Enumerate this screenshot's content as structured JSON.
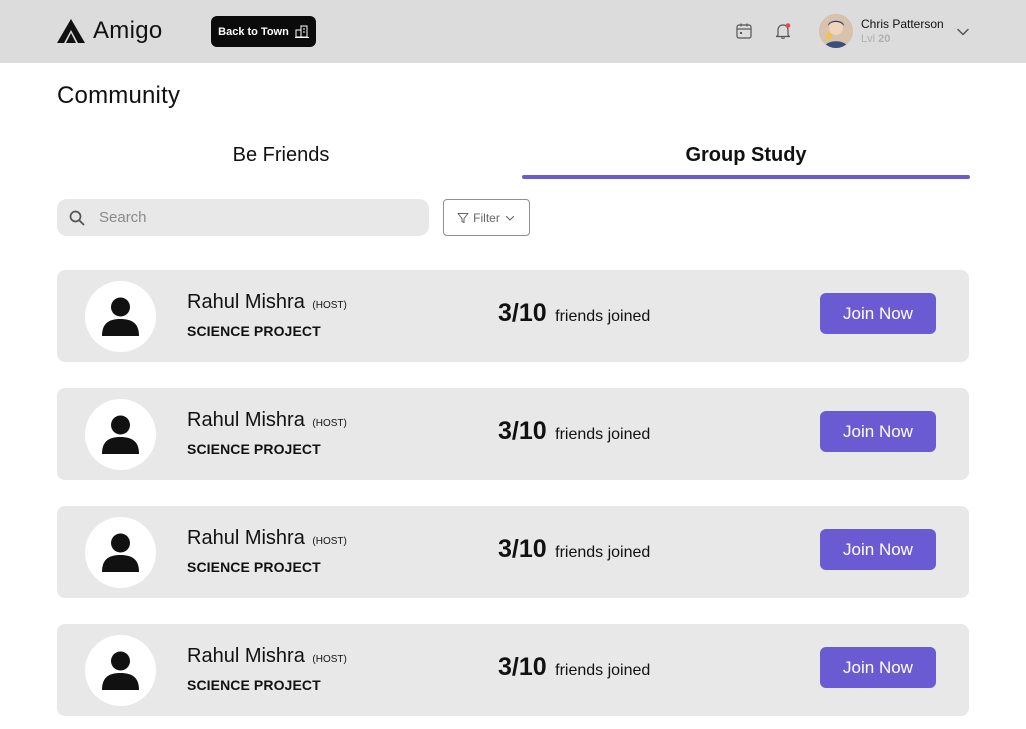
{
  "header": {
    "brand": "Amigo",
    "back_button_label": "Back to Town",
    "user": {
      "name": "Chris Patterson",
      "level_prefix": "Lvl",
      "level": "20"
    },
    "icons": [
      "calendar-icon",
      "bell-icon",
      "chevron-down-icon"
    ]
  },
  "page": {
    "title": "Community"
  },
  "tabs": [
    {
      "label": "Be Friends",
      "active": false
    },
    {
      "label": "Group Study",
      "active": true
    }
  ],
  "search": {
    "placeholder": "Search",
    "value": ""
  },
  "filter": {
    "label": "Filter"
  },
  "groups": [
    {
      "host": "Rahul Mishra",
      "host_tag": "(HOST)",
      "project": "SCIENCE PROJECT",
      "joined": "3/10",
      "joined_text": "friends joined",
      "action": "Join Now"
    },
    {
      "host": "Rahul Mishra",
      "host_tag": "(HOST)",
      "project": "SCIENCE PROJECT",
      "joined": "3/10",
      "joined_text": "friends joined",
      "action": "Join Now"
    },
    {
      "host": "Rahul Mishra",
      "host_tag": "(HOST)",
      "project": "SCIENCE PROJECT",
      "joined": "3/10",
      "joined_text": "friends joined",
      "action": "Join Now"
    },
    {
      "host": "Rahul Mishra",
      "host_tag": "(HOST)",
      "project": "SCIENCE PROJECT",
      "joined": "3/10",
      "joined_text": "friends joined",
      "action": "Join Now"
    }
  ],
  "colors": {
    "accent": "#6b5bd2",
    "header_bg": "#dcdcdc",
    "card_bg": "#e8e8e8"
  }
}
